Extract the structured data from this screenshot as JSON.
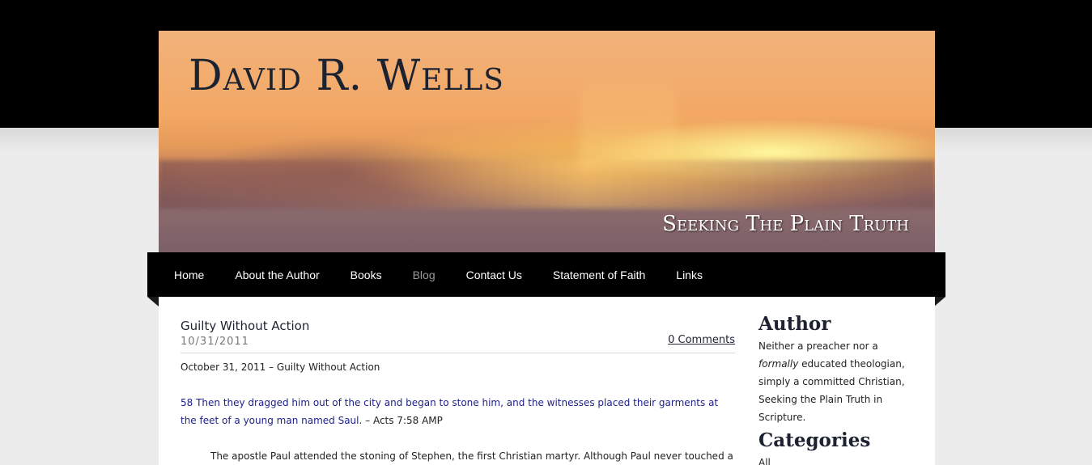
{
  "header": {
    "site_title": "David R. Wells",
    "tagline": "Seeking The Plain Truth"
  },
  "nav": {
    "items": [
      {
        "label": "Home"
      },
      {
        "label": "About the Author"
      },
      {
        "label": "Books"
      },
      {
        "label": "Blog",
        "active": true
      },
      {
        "label": "Contact Us"
      },
      {
        "label": "Statement of Faith"
      },
      {
        "label": "Links"
      }
    ]
  },
  "post": {
    "title": "Guilty Without Action",
    "date": "10/31/2011",
    "comments": "0 Comments",
    "heading_line": "October 31, 2011 – Guilty Without Action",
    "scripture": "58 Then they dragged him out of the city and began to stone him, and the witnesses placed their garments at the feet of a young man named Saul.",
    "scripture_ref": " – Acts 7:58 AMP",
    "body_start": "The apostle Paul attended the stoning of Stephen, the first Christian martyr.  Although Paul never touched a"
  },
  "sidebar": {
    "author_heading": "Author",
    "author_pre": "Neither a preacher nor a ",
    "author_em": "formally",
    "author_post": " educated theologian, simply a committed Christian, Seeking the Plain Truth in Scripture.",
    "categories_heading": "Categories",
    "first_category": "All"
  },
  "colors": {
    "nav_bg": "#000000",
    "page_bg": "#ececec",
    "title_color": "#1d2231",
    "scripture_color": "#1c1f8a",
    "active_nav": "#9a9a9a"
  }
}
